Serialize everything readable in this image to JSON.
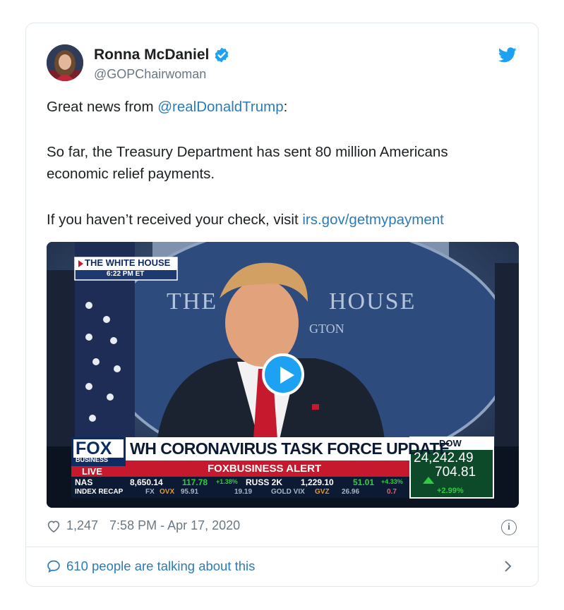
{
  "tweet": {
    "author_name": "Ronna McDaniel",
    "handle": "@GOPChairwoman",
    "line1_prefix": "Great news from ",
    "line1_mention": "@realDonaldTrump",
    "line1_suffix": ":",
    "para2_line1": "So far, the Treasury Department has sent 80 million Americans",
    "para2_line2": "economic relief payments.",
    "para3_prefix": "If you haven’t received your check, visit ",
    "para3_link": "irs.gov/getmypayment"
  },
  "video": {
    "bug_title": "THE WHITE HOUSE",
    "bug_time": "6:22 PM ET",
    "backdrop_left": "THE",
    "backdrop_right": "HOUSE",
    "backdrop_sub": "GTON",
    "channel_logo": "FOX",
    "channel_sub": "BUSINESS",
    "live_label": "LIVE",
    "headline": "WH CORONAVIRUS TASK FORCE UPDATE",
    "alert_label": "FOXBUSINESS ALERT",
    "ticker_left": "NAS",
    "ticker_nas_value": "8,650.14",
    "ticker_nas_change": "117.78",
    "ticker_nas_pct": "+1.38%",
    "ticker_russ_label": "RUSS 2K",
    "ticker_russ_value": "1,229.10",
    "ticker_russ_change": "51.01",
    "ticker_russ_pct": "+4.33%",
    "ticker_row2_label": "INDEX RECAP",
    "ticker_row2_a": "FX",
    "ticker_row2_b": "OVX",
    "ticker_row2_c": "95.91",
    "ticker_row2_d": "19.19",
    "ticker_row2_e": "GOLD VIX",
    "ticker_row2_f": "GVZ",
    "ticker_row2_g": "26.96",
    "ticker_row2_h": "0.7",
    "dow_label": "DOW",
    "dow_value": "24,242.49",
    "dow_change": "704.81",
    "dow_pct": "+2.99%"
  },
  "meta": {
    "likes": "1,247",
    "timestamp": "7:58 PM - Apr 17, 2020",
    "info_glyph": "i"
  },
  "footer": {
    "talk_text": "610 people are talking about this"
  },
  "colors": {
    "link": "#2b7bb9",
    "twitter_blue": "#1da1f2",
    "muted": "#697882"
  }
}
